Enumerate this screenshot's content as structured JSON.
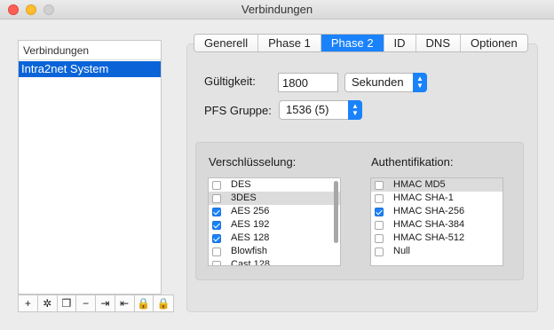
{
  "window": {
    "title": "Verbindungen"
  },
  "sidebar": {
    "header": "Verbindungen",
    "items": [
      {
        "label": "Intra2net System",
        "selected": true
      }
    ],
    "toolbar": [
      {
        "icon": "add-icon",
        "glyph": "+"
      },
      {
        "icon": "magic-wand-icon",
        "glyph": "✲"
      },
      {
        "icon": "duplicate-icon",
        "glyph": "❐"
      },
      {
        "icon": "remove-icon",
        "glyph": "−"
      },
      {
        "icon": "import-icon",
        "glyph": "⇥"
      },
      {
        "icon": "export-icon",
        "glyph": "⇤"
      },
      {
        "icon": "lock-icon",
        "glyph": "🔒"
      },
      {
        "icon": "unlock-icon",
        "glyph": "🔒"
      }
    ]
  },
  "tabs": [
    {
      "label": "Generell",
      "active": false
    },
    {
      "label": "Phase 1",
      "active": false
    },
    {
      "label": "Phase 2",
      "active": true
    },
    {
      "label": "ID",
      "active": false
    },
    {
      "label": "DNS",
      "active": false
    },
    {
      "label": "Optionen",
      "active": false
    }
  ],
  "phase2": {
    "lifetime_label": "Gültigkeit:",
    "lifetime_value": "1800",
    "lifetime_unit": "Sekunden",
    "pfs_label": "PFS Gruppe:",
    "pfs_value": "1536 (5)",
    "encryption_label": "Verschlüsselung:",
    "authentication_label": "Authentifikation:",
    "encryption": [
      {
        "label": "DES",
        "checked": false,
        "highlighted": false
      },
      {
        "label": "3DES",
        "checked": false,
        "highlighted": true
      },
      {
        "label": "AES 256",
        "checked": true,
        "highlighted": false
      },
      {
        "label": "AES 192",
        "checked": true,
        "highlighted": false
      },
      {
        "label": "AES 128",
        "checked": true,
        "highlighted": false
      },
      {
        "label": "Blowfish",
        "checked": false,
        "highlighted": false
      },
      {
        "label": "Cast 128",
        "checked": false,
        "highlighted": false
      }
    ],
    "authentication": [
      {
        "label": "HMAC MD5",
        "checked": false,
        "highlighted": true
      },
      {
        "label": "HMAC SHA-1",
        "checked": false,
        "highlighted": false
      },
      {
        "label": "HMAC SHA-256",
        "checked": true,
        "highlighted": false
      },
      {
        "label": "HMAC SHA-384",
        "checked": false,
        "highlighted": false
      },
      {
        "label": "HMAC SHA-512",
        "checked": false,
        "highlighted": false
      },
      {
        "label": "Null",
        "checked": false,
        "highlighted": false
      }
    ]
  },
  "colors": {
    "accent": "#1a82fb",
    "selection": "#0a64d8"
  }
}
